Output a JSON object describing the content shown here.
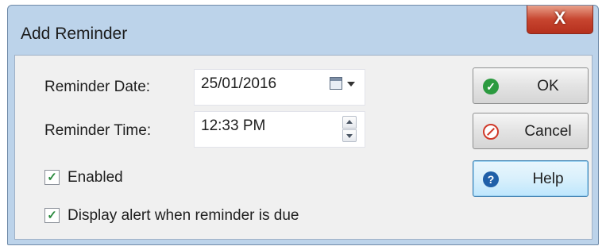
{
  "window": {
    "title": "Add Reminder",
    "close_label": "X"
  },
  "form": {
    "date_label": "Reminder Date:",
    "date_value": "25/01/2016",
    "time_label": "Reminder Time:",
    "time_value": "12:33 PM"
  },
  "options": {
    "enabled_label": "Enabled",
    "enabled_checked": true,
    "alert_label": "Display alert when reminder is due",
    "alert_checked": true,
    "check_glyph": "✓"
  },
  "buttons": {
    "ok_label": "OK",
    "cancel_label": "Cancel",
    "help_label": "Help",
    "help_glyph": "?"
  },
  "colors": {
    "ok_icon": "#2b9a3f",
    "cancel_icon": "#d03a2a",
    "help_icon": "#1f5fa8",
    "close_button": "#c7452f"
  }
}
